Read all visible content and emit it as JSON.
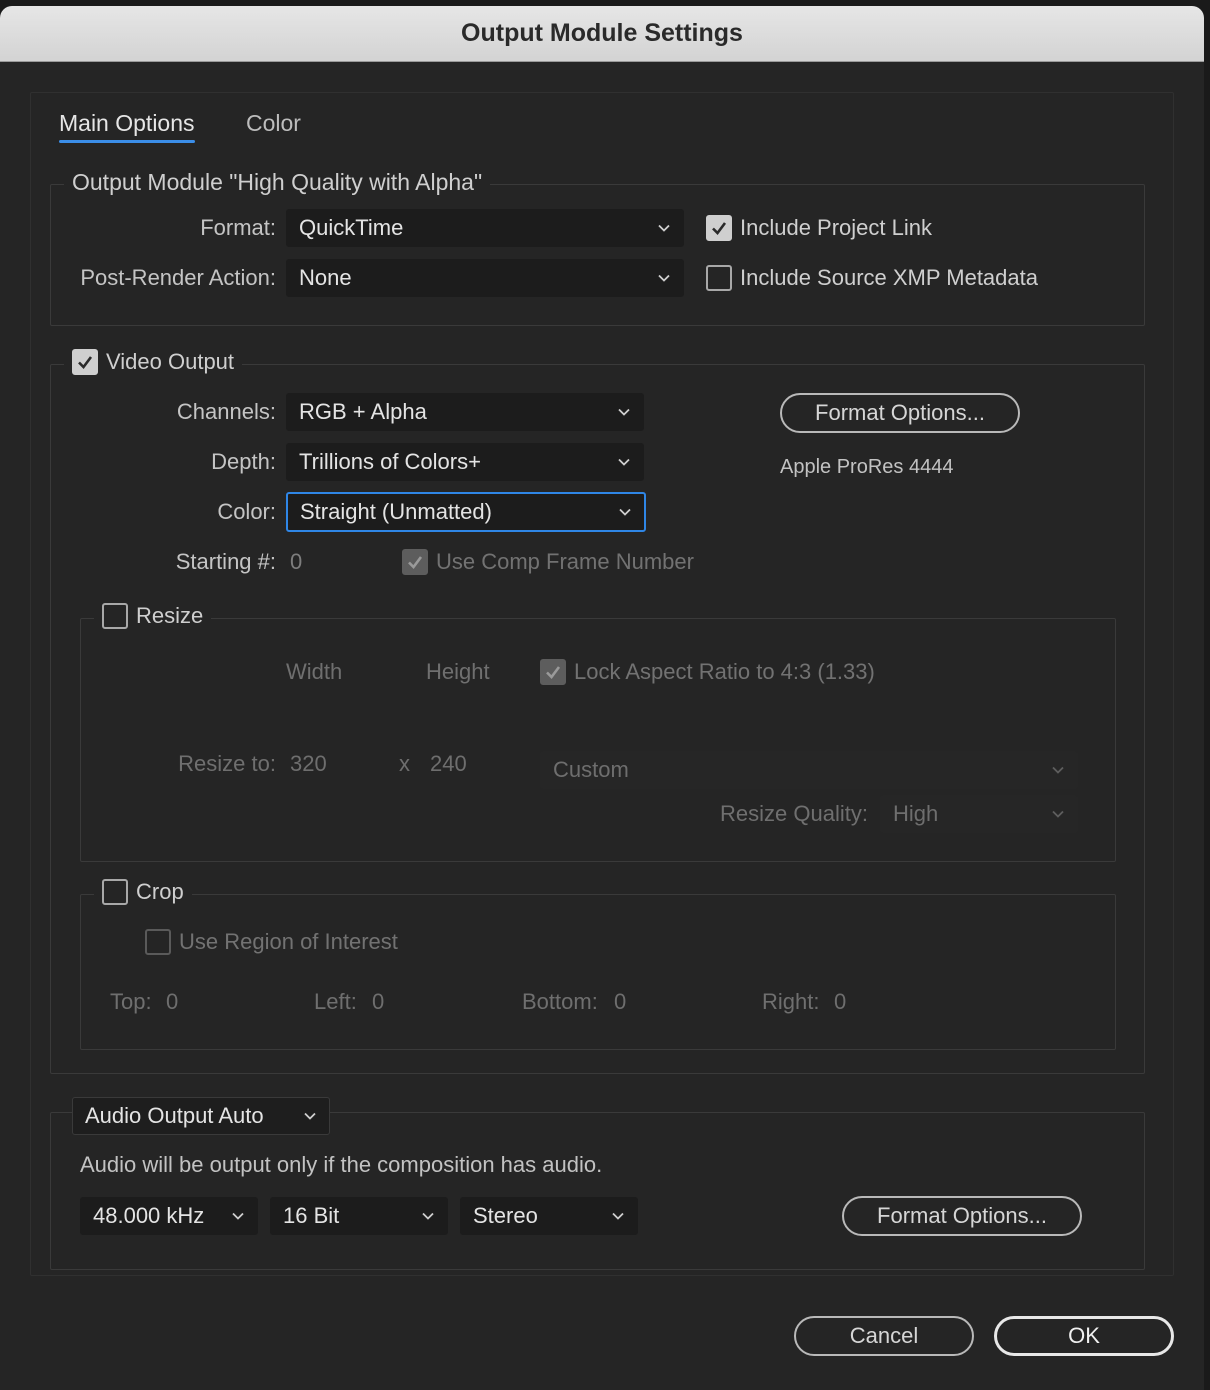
{
  "window": {
    "title": "Output Module Settings"
  },
  "tabs": [
    {
      "label": "Main Options",
      "active": true
    },
    {
      "label": "Color",
      "active": false
    }
  ],
  "output_module": {
    "legend": "Output Module \"High Quality with Alpha\"",
    "format_label": "Format:",
    "format_value": "QuickTime",
    "post_render_label": "Post-Render Action:",
    "post_render_value": "None",
    "include_project_link": {
      "label": "Include Project Link",
      "checked": true
    },
    "include_xmp": {
      "label": "Include Source XMP Metadata",
      "checked": false
    }
  },
  "video_output": {
    "label": "Video Output",
    "checked": true,
    "channels_label": "Channels:",
    "channels_value": "RGB + Alpha",
    "depth_label": "Depth:",
    "depth_value": "Trillions of Colors+",
    "color_label": "Color:",
    "color_value": "Straight (Unmatted)",
    "starting_label": "Starting #:",
    "starting_value": "0",
    "use_comp_frame": {
      "label": "Use Comp Frame Number",
      "checked": true
    },
    "format_options_button": "Format Options...",
    "codec_note": "Apple ProRes 4444"
  },
  "resize": {
    "label": "Resize",
    "checked": false,
    "width_header": "Width",
    "height_header": "Height",
    "lock_aspect": {
      "label": "Lock Aspect Ratio to 4:3 (1.33)",
      "checked": true
    },
    "resize_to_label": "Resize to:",
    "width_value": "320",
    "x_sep": "x",
    "height_value": "240",
    "preset_value": "Custom",
    "quality_label": "Resize Quality:",
    "quality_value": "High"
  },
  "crop": {
    "label": "Crop",
    "checked": false,
    "use_roi": {
      "label": "Use Region of Interest",
      "checked": false
    },
    "top_label": "Top:",
    "top_value": "0",
    "left_label": "Left:",
    "left_value": "0",
    "bottom_label": "Bottom:",
    "bottom_value": "0",
    "right_label": "Right:",
    "right_value": "0"
  },
  "audio": {
    "mode_value": "Audio Output Auto",
    "note": "Audio will be output only if the composition has audio.",
    "rate_value": "48.000 kHz",
    "bits_value": "16 Bit",
    "channels_value": "Stereo",
    "format_options_button": "Format Options..."
  },
  "footer": {
    "cancel_label": "Cancel",
    "ok_label": "OK"
  },
  "icons": {
    "dropdown": "chevron-down-icon",
    "check": "checkmark-icon"
  },
  "colors": {
    "accent": "#2f86e6",
    "window_bg": "#252525",
    "field_bg": "#1c1c1c"
  }
}
